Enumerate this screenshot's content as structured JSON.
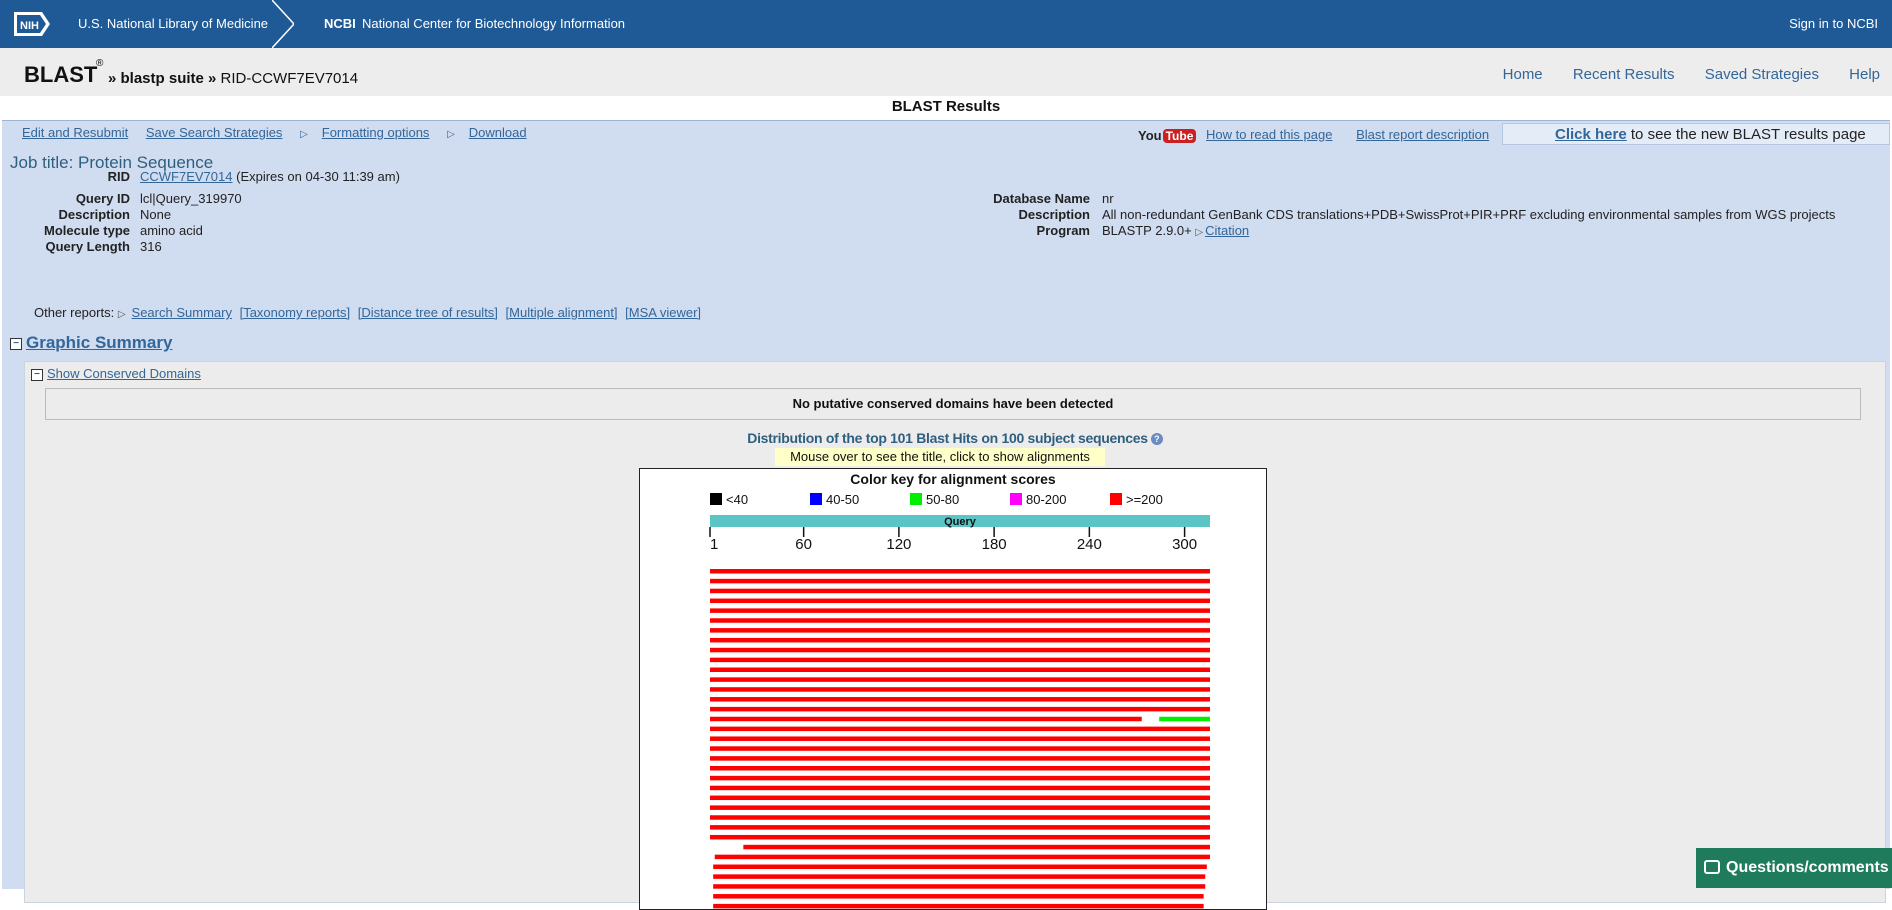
{
  "nih_bar": {
    "logo_text": "NIH",
    "library": "U.S. National Library of Medicine",
    "ncbi_abbr": "NCBI",
    "ncbi_full": "National Center for Biotechnology Information",
    "sign_in": "Sign in to NCBI"
  },
  "blast_header": {
    "logo": "BLAST",
    "registered": "®",
    "crumbs_prefix": "» blastp suite »",
    "rid_crumb": "RID-CCWF7EV7014",
    "nav": [
      "Home",
      "Recent Results",
      "Saved Strategies",
      "Help"
    ]
  },
  "results_title": "BLAST Results",
  "toolbar": {
    "edit": "Edit and Resubmit",
    "save": "Save Search Strategies",
    "formatting": "Formatting options",
    "download": "Download",
    "youtube_you": "You",
    "youtube_tube": "Tube",
    "how_to_read": "How to read this page",
    "report_desc": "Blast report description",
    "new_results_link": "Click here",
    "new_results_text": " to see the new BLAST results page"
  },
  "job_title": "Job title: Protein Sequence",
  "summary_left": {
    "rid_label": "RID",
    "rid_value": "CCWF7EV7014",
    "rid_expires": "(Expires on 04-30 11:39 am)",
    "query_id_label": "Query ID",
    "query_id": "lcl|Query_319970",
    "description_label": "Description",
    "description": "None",
    "molecule_label": "Molecule type",
    "molecule": "amino acid",
    "length_label": "Query Length",
    "length": "316"
  },
  "summary_right": {
    "db_label": "Database Name",
    "db": "nr",
    "desc_label": "Description",
    "desc": "All non-redundant GenBank CDS translations+PDB+SwissProt+PIR+PRF excluding environmental samples from WGS projects",
    "program_label": "Program",
    "program": "BLASTP 2.9.0+",
    "citation": "Citation"
  },
  "other_reports": {
    "label": "Other reports:",
    "links": [
      "Search Summary",
      "[Taxonomy reports]",
      "[Distance tree of results]",
      "[Multiple alignment]",
      "[MSA viewer]"
    ]
  },
  "graphic_summary": {
    "title": "Graphic Summary",
    "show_cdd": "Show Conserved Domains",
    "no_domains": "No putative conserved domains have been detected",
    "dist_title": "Distribution of the top 101 Blast Hits on 100 subject sequences",
    "help": "?",
    "mouse_tip": "Mouse over to see the title, click to show alignments"
  },
  "chart_data": {
    "type": "alignment_overview",
    "title": "Color key for alignment scores",
    "legend": [
      {
        "label": "<40",
        "color": "#000000"
      },
      {
        "label": "40-50",
        "color": "#0000ff"
      },
      {
        "label": "50-80",
        "color": "#00ee00"
      },
      {
        "label": "80-200",
        "color": "#ff00ff"
      },
      {
        "label": ">=200",
        "color": "#ff0000"
      }
    ],
    "query_label": "Query",
    "query_length": 316,
    "ticks": [
      1,
      60,
      120,
      180,
      240,
      300
    ],
    "hits": [
      {
        "segments": [
          {
            "start": 1,
            "end": 316,
            "color": "#ff0000"
          }
        ]
      },
      {
        "segments": [
          {
            "start": 1,
            "end": 316,
            "color": "#ff0000"
          }
        ]
      },
      {
        "segments": [
          {
            "start": 1,
            "end": 316,
            "color": "#ff0000"
          }
        ]
      },
      {
        "segments": [
          {
            "start": 1,
            "end": 316,
            "color": "#ff0000"
          }
        ]
      },
      {
        "segments": [
          {
            "start": 1,
            "end": 316,
            "color": "#ff0000"
          }
        ]
      },
      {
        "segments": [
          {
            "start": 1,
            "end": 316,
            "color": "#ff0000"
          }
        ]
      },
      {
        "segments": [
          {
            "start": 1,
            "end": 316,
            "color": "#ff0000"
          }
        ]
      },
      {
        "segments": [
          {
            "start": 1,
            "end": 316,
            "color": "#ff0000"
          }
        ]
      },
      {
        "segments": [
          {
            "start": 1,
            "end": 316,
            "color": "#ff0000"
          }
        ]
      },
      {
        "segments": [
          {
            "start": 1,
            "end": 316,
            "color": "#ff0000"
          }
        ]
      },
      {
        "segments": [
          {
            "start": 1,
            "end": 316,
            "color": "#ff0000"
          }
        ]
      },
      {
        "segments": [
          {
            "start": 1,
            "end": 316,
            "color": "#ff0000"
          }
        ]
      },
      {
        "segments": [
          {
            "start": 1,
            "end": 316,
            "color": "#ff0000"
          }
        ]
      },
      {
        "segments": [
          {
            "start": 1,
            "end": 316,
            "color": "#ff0000"
          }
        ]
      },
      {
        "segments": [
          {
            "start": 1,
            "end": 316,
            "color": "#ff0000"
          }
        ]
      },
      {
        "segments": [
          {
            "start": 1,
            "end": 273,
            "color": "#ff0000"
          },
          {
            "start": 284,
            "end": 316,
            "color": "#00ee00"
          }
        ]
      },
      {
        "segments": [
          {
            "start": 1,
            "end": 316,
            "color": "#ff0000"
          }
        ]
      },
      {
        "segments": [
          {
            "start": 1,
            "end": 316,
            "color": "#ff0000"
          }
        ]
      },
      {
        "segments": [
          {
            "start": 1,
            "end": 316,
            "color": "#ff0000"
          }
        ]
      },
      {
        "segments": [
          {
            "start": 1,
            "end": 316,
            "color": "#ff0000"
          }
        ]
      },
      {
        "segments": [
          {
            "start": 1,
            "end": 316,
            "color": "#ff0000"
          }
        ]
      },
      {
        "segments": [
          {
            "start": 1,
            "end": 316,
            "color": "#ff0000"
          }
        ]
      },
      {
        "segments": [
          {
            "start": 1,
            "end": 316,
            "color": "#ff0000"
          }
        ]
      },
      {
        "segments": [
          {
            "start": 1,
            "end": 316,
            "color": "#ff0000"
          }
        ]
      },
      {
        "segments": [
          {
            "start": 1,
            "end": 316,
            "color": "#ff0000"
          }
        ]
      },
      {
        "segments": [
          {
            "start": 1,
            "end": 316,
            "color": "#ff0000"
          }
        ]
      },
      {
        "segments": [
          {
            "start": 1,
            "end": 316,
            "color": "#ff0000"
          }
        ]
      },
      {
        "segments": [
          {
            "start": 1,
            "end": 316,
            "color": "#ff0000"
          }
        ]
      },
      {
        "segments": [
          {
            "start": 22,
            "end": 316,
            "color": "#ff0000"
          }
        ]
      },
      {
        "segments": [
          {
            "start": 4,
            "end": 316,
            "color": "#ff0000"
          }
        ]
      },
      {
        "segments": [
          {
            "start": 3,
            "end": 314,
            "color": "#ff0000"
          }
        ]
      },
      {
        "segments": [
          {
            "start": 3,
            "end": 313,
            "color": "#ff0000"
          }
        ]
      },
      {
        "segments": [
          {
            "start": 3,
            "end": 313,
            "color": "#ff0000"
          }
        ]
      },
      {
        "segments": [
          {
            "start": 3,
            "end": 312,
            "color": "#ff0000"
          }
        ]
      },
      {
        "segments": [
          {
            "start": 3,
            "end": 312,
            "color": "#ff0000"
          }
        ]
      },
      {
        "segments": [
          {
            "start": 3,
            "end": 311,
            "color": "#ff0000"
          }
        ]
      }
    ]
  },
  "feedback": "Questions/comments",
  "colors": {
    "nih_blue": "#1f5a96",
    "panel_blue": "#d0dcf0",
    "link": "#336699",
    "query_bar": "#5bc4c4",
    "feedback_green": "#1e7c5d"
  }
}
